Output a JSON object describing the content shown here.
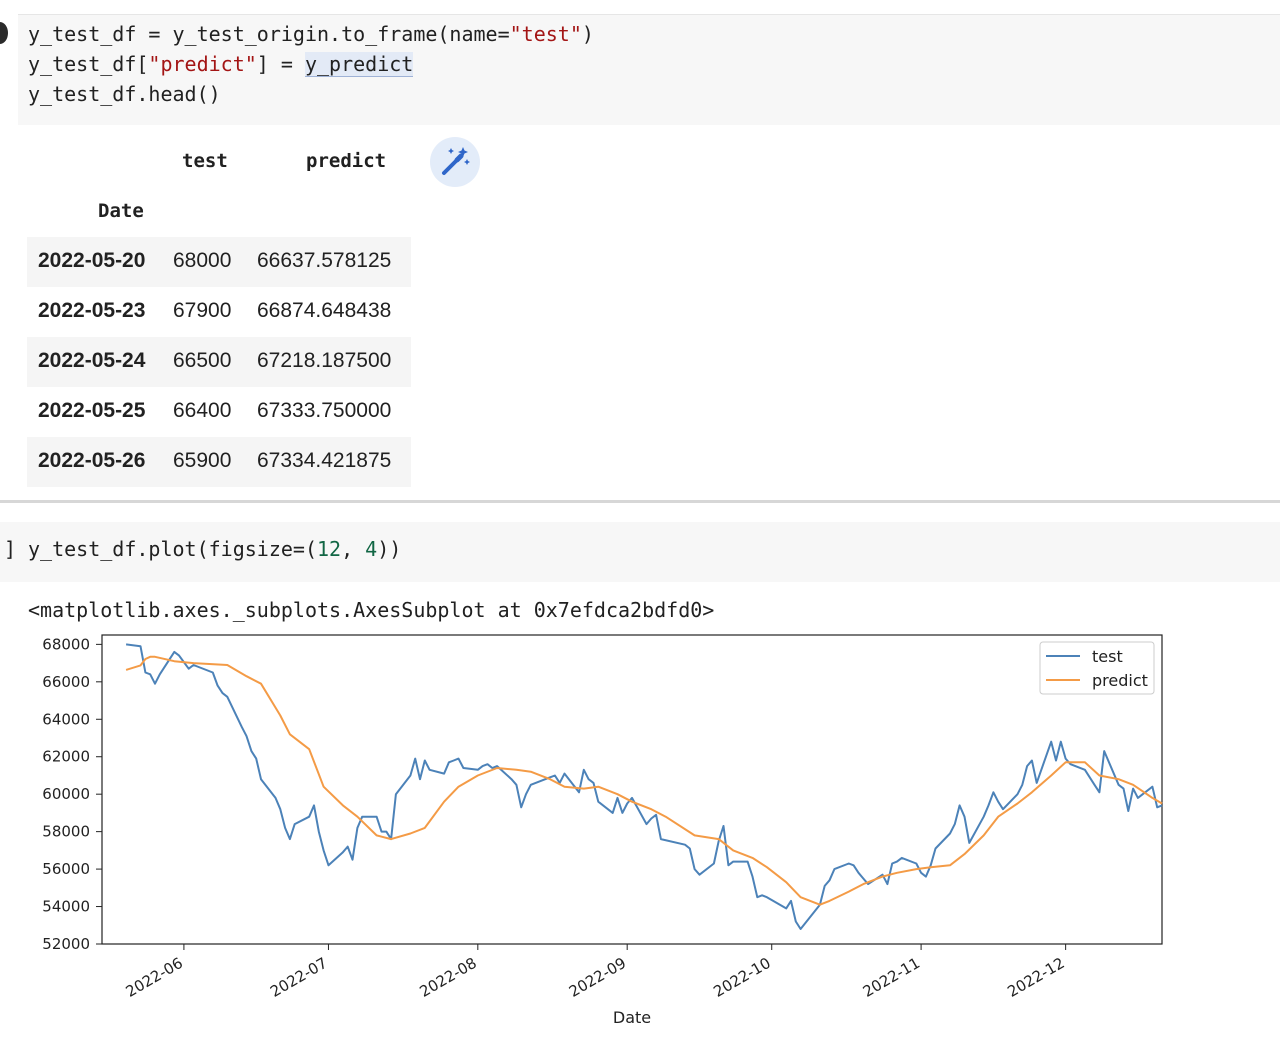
{
  "cell1": {
    "code_lines": [
      {
        "parts": [
          {
            "t": "y_test_df = y_test_origin.to_frame(name="
          },
          {
            "t": "\"test\"",
            "c": "str"
          },
          {
            "t": ")"
          }
        ]
      },
      {
        "parts": [
          {
            "t": "y_test_df["
          },
          {
            "t": "\"predict\"",
            "c": "str"
          },
          {
            "t": "] = "
          },
          {
            "t": "y_predict",
            "c": "hl"
          }
        ]
      },
      {
        "parts": [
          {
            "t": "y_test_df.head()"
          }
        ]
      }
    ]
  },
  "table": {
    "columns": [
      "test",
      "predict"
    ],
    "index_name": "Date",
    "rows": [
      {
        "date": "2022-05-20",
        "test": "68000",
        "predict": "66637.578125"
      },
      {
        "date": "2022-05-23",
        "test": "67900",
        "predict": "66874.648438"
      },
      {
        "date": "2022-05-24",
        "test": "66500",
        "predict": "67218.187500"
      },
      {
        "date": "2022-05-25",
        "test": "66400",
        "predict": "67333.750000"
      },
      {
        "date": "2022-05-26",
        "test": "65900",
        "predict": "67334.421875"
      }
    ]
  },
  "cell2": {
    "bracket": "]",
    "code_parts": [
      {
        "t": "y_test_df.plot(figsize=("
      },
      {
        "t": "12",
        "c": "num"
      },
      {
        "t": ", "
      },
      {
        "t": "4",
        "c": "num"
      },
      {
        "t": "))"
      }
    ],
    "output_repr": "<matplotlib.axes._subplots.AxesSubplot at 0x7efdca2bdfd0>"
  },
  "colors": {
    "test": "#4c82b8",
    "predict": "#f49b46",
    "string": "#a31515",
    "number": "#116644"
  },
  "chart_data": {
    "type": "line",
    "xlabel": "Date",
    "ylabel": "",
    "ylim": [
      52000,
      68500
    ],
    "xlim": [
      "2022-05-15",
      "2022-12-21"
    ],
    "yticks": [
      "52000",
      "54000",
      "56000",
      "58000",
      "60000",
      "62000",
      "64000",
      "66000",
      "68000"
    ],
    "xticks": [
      {
        "label": "2022-06",
        "date": "2022-06-01"
      },
      {
        "label": "2022-07",
        "date": "2022-07-01"
      },
      {
        "label": "2022-08",
        "date": "2022-08-01"
      },
      {
        "label": "2022-09",
        "date": "2022-09-01"
      },
      {
        "label": "2022-10",
        "date": "2022-10-01"
      },
      {
        "label": "2022-11",
        "date": "2022-11-01"
      },
      {
        "label": "2022-12",
        "date": "2022-12-01"
      }
    ],
    "legend": {
      "position": "top-right"
    },
    "series": [
      {
        "name": "test",
        "color": "#4c82b8",
        "points": [
          [
            "2022-05-20",
            68000
          ],
          [
            "2022-05-23",
            67900
          ],
          [
            "2022-05-24",
            66500
          ],
          [
            "2022-05-25",
            66400
          ],
          [
            "2022-05-26",
            65900
          ],
          [
            "2022-05-27",
            66400
          ],
          [
            "2022-05-30",
            67600
          ],
          [
            "2022-05-31",
            67400
          ],
          [
            "2022-06-02",
            66700
          ],
          [
            "2022-06-03",
            66900
          ],
          [
            "2022-06-07",
            66500
          ],
          [
            "2022-06-08",
            65800
          ],
          [
            "2022-06-09",
            65400
          ],
          [
            "2022-06-10",
            65200
          ],
          [
            "2022-06-13",
            63600
          ],
          [
            "2022-06-14",
            63100
          ],
          [
            "2022-06-15",
            62300
          ],
          [
            "2022-06-16",
            61900
          ],
          [
            "2022-06-17",
            60800
          ],
          [
            "2022-06-20",
            59800
          ],
          [
            "2022-06-21",
            59200
          ],
          [
            "2022-06-22",
            58200
          ],
          [
            "2022-06-23",
            57600
          ],
          [
            "2022-06-24",
            58400
          ],
          [
            "2022-06-27",
            58800
          ],
          [
            "2022-06-28",
            59400
          ],
          [
            "2022-06-29",
            58000
          ],
          [
            "2022-06-30",
            57000
          ],
          [
            "2022-07-01",
            56200
          ],
          [
            "2022-07-04",
            56900
          ],
          [
            "2022-07-05",
            57200
          ],
          [
            "2022-07-06",
            56500
          ],
          [
            "2022-07-07",
            58200
          ],
          [
            "2022-07-08",
            58800
          ],
          [
            "2022-07-11",
            58800
          ],
          [
            "2022-07-12",
            58000
          ],
          [
            "2022-07-13",
            58000
          ],
          [
            "2022-07-14",
            57600
          ],
          [
            "2022-07-15",
            60000
          ],
          [
            "2022-07-18",
            61000
          ],
          [
            "2022-07-19",
            61900
          ],
          [
            "2022-07-20",
            60800
          ],
          [
            "2022-07-21",
            61800
          ],
          [
            "2022-07-22",
            61300
          ],
          [
            "2022-07-25",
            61100
          ],
          [
            "2022-07-26",
            61700
          ],
          [
            "2022-07-27",
            61800
          ],
          [
            "2022-07-28",
            61900
          ],
          [
            "2022-07-29",
            61400
          ],
          [
            "2022-08-01",
            61300
          ],
          [
            "2022-08-02",
            61500
          ],
          [
            "2022-08-03",
            61600
          ],
          [
            "2022-08-04",
            61400
          ],
          [
            "2022-08-05",
            61500
          ],
          [
            "2022-08-08",
            60800
          ],
          [
            "2022-08-09",
            60500
          ],
          [
            "2022-08-10",
            59300
          ],
          [
            "2022-08-11",
            60000
          ],
          [
            "2022-08-12",
            60500
          ],
          [
            "2022-08-16",
            60900
          ],
          [
            "2022-08-17",
            61000
          ],
          [
            "2022-08-18",
            60600
          ],
          [
            "2022-08-19",
            61100
          ],
          [
            "2022-08-22",
            60100
          ],
          [
            "2022-08-23",
            61300
          ],
          [
            "2022-08-24",
            60800
          ],
          [
            "2022-08-25",
            60600
          ],
          [
            "2022-08-26",
            59600
          ],
          [
            "2022-08-29",
            59000
          ],
          [
            "2022-08-30",
            59800
          ],
          [
            "2022-08-31",
            59000
          ],
          [
            "2022-09-01",
            59500
          ],
          [
            "2022-09-02",
            59800
          ],
          [
            "2022-09-05",
            58400
          ],
          [
            "2022-09-06",
            58700
          ],
          [
            "2022-09-07",
            58900
          ],
          [
            "2022-09-08",
            57600
          ],
          [
            "2022-09-13",
            57300
          ],
          [
            "2022-09-14",
            57100
          ],
          [
            "2022-09-15",
            56000
          ],
          [
            "2022-09-16",
            55700
          ],
          [
            "2022-09-19",
            56300
          ],
          [
            "2022-09-20",
            57500
          ],
          [
            "2022-09-21",
            58300
          ],
          [
            "2022-09-22",
            56200
          ],
          [
            "2022-09-23",
            56400
          ],
          [
            "2022-09-26",
            56400
          ],
          [
            "2022-09-27",
            55600
          ],
          [
            "2022-09-28",
            54500
          ],
          [
            "2022-09-29",
            54600
          ],
          [
            "2022-09-30",
            54500
          ],
          [
            "2022-10-04",
            53900
          ],
          [
            "2022-10-05",
            54300
          ],
          [
            "2022-10-06",
            53200
          ],
          [
            "2022-10-07",
            52800
          ],
          [
            "2022-10-11",
            54100
          ],
          [
            "2022-10-12",
            55100
          ],
          [
            "2022-10-13",
            55400
          ],
          [
            "2022-10-14",
            56000
          ],
          [
            "2022-10-17",
            56300
          ],
          [
            "2022-10-18",
            56200
          ],
          [
            "2022-10-19",
            55800
          ],
          [
            "2022-10-20",
            55500
          ],
          [
            "2022-10-21",
            55200
          ],
          [
            "2022-10-24",
            55700
          ],
          [
            "2022-10-25",
            55200
          ],
          [
            "2022-10-26",
            56300
          ],
          [
            "2022-10-27",
            56400
          ],
          [
            "2022-10-28",
            56600
          ],
          [
            "2022-10-31",
            56300
          ],
          [
            "2022-11-01",
            55800
          ],
          [
            "2022-11-02",
            55600
          ],
          [
            "2022-11-03",
            56200
          ],
          [
            "2022-11-04",
            57100
          ],
          [
            "2022-11-07",
            57900
          ],
          [
            "2022-11-08",
            58400
          ],
          [
            "2022-11-09",
            59400
          ],
          [
            "2022-11-10",
            58800
          ],
          [
            "2022-11-11",
            57400
          ],
          [
            "2022-11-14",
            58800
          ],
          [
            "2022-11-15",
            59400
          ],
          [
            "2022-11-16",
            60100
          ],
          [
            "2022-11-17",
            59600
          ],
          [
            "2022-11-18",
            59200
          ],
          [
            "2022-11-21",
            60000
          ],
          [
            "2022-11-22",
            60500
          ],
          [
            "2022-11-23",
            61500
          ],
          [
            "2022-11-24",
            61800
          ],
          [
            "2022-11-25",
            60600
          ],
          [
            "2022-11-28",
            62800
          ],
          [
            "2022-11-29",
            61800
          ],
          [
            "2022-11-30",
            62800
          ],
          [
            "2022-12-01",
            61900
          ],
          [
            "2022-12-02",
            61600
          ],
          [
            "2022-12-05",
            61300
          ],
          [
            "2022-12-06",
            60900
          ],
          [
            "2022-12-07",
            60500
          ],
          [
            "2022-12-08",
            60100
          ],
          [
            "2022-12-09",
            62300
          ],
          [
            "2022-12-12",
            60500
          ],
          [
            "2022-12-13",
            60300
          ],
          [
            "2022-12-14",
            59100
          ],
          [
            "2022-12-15",
            60300
          ],
          [
            "2022-12-16",
            59800
          ],
          [
            "2022-12-19",
            60400
          ],
          [
            "2022-12-20",
            59300
          ],
          [
            "2022-12-21",
            59400
          ]
        ]
      },
      {
        "name": "predict",
        "color": "#f49b46",
        "points": [
          [
            "2022-05-20",
            66638
          ],
          [
            "2022-05-23",
            66875
          ],
          [
            "2022-05-24",
            67218
          ],
          [
            "2022-05-25",
            67334
          ],
          [
            "2022-05-26",
            67334
          ],
          [
            "2022-05-30",
            67100
          ],
          [
            "2022-06-03",
            67000
          ],
          [
            "2022-06-10",
            66900
          ],
          [
            "2022-06-14",
            66300
          ],
          [
            "2022-06-17",
            65900
          ],
          [
            "2022-06-21",
            64200
          ],
          [
            "2022-06-23",
            63200
          ],
          [
            "2022-06-27",
            62400
          ],
          [
            "2022-06-30",
            60400
          ],
          [
            "2022-07-04",
            59400
          ],
          [
            "2022-07-07",
            58800
          ],
          [
            "2022-07-11",
            57800
          ],
          [
            "2022-07-14",
            57600
          ],
          [
            "2022-07-18",
            57900
          ],
          [
            "2022-07-21",
            58200
          ],
          [
            "2022-07-25",
            59600
          ],
          [
            "2022-07-28",
            60400
          ],
          [
            "2022-08-01",
            61000
          ],
          [
            "2022-08-05",
            61400
          ],
          [
            "2022-08-09",
            61300
          ],
          [
            "2022-08-12",
            61200
          ],
          [
            "2022-08-16",
            60800
          ],
          [
            "2022-08-19",
            60400
          ],
          [
            "2022-08-23",
            60300
          ],
          [
            "2022-08-26",
            60400
          ],
          [
            "2022-08-30",
            60000
          ],
          [
            "2022-09-02",
            59600
          ],
          [
            "2022-09-06",
            59200
          ],
          [
            "2022-09-09",
            58800
          ],
          [
            "2022-09-15",
            57800
          ],
          [
            "2022-09-20",
            57600
          ],
          [
            "2022-09-23",
            57000
          ],
          [
            "2022-09-27",
            56600
          ],
          [
            "2022-09-30",
            56100
          ],
          [
            "2022-10-04",
            55300
          ],
          [
            "2022-10-07",
            54500
          ],
          [
            "2022-10-11",
            54100
          ],
          [
            "2022-10-13",
            54300
          ],
          [
            "2022-10-17",
            54800
          ],
          [
            "2022-10-20",
            55200
          ],
          [
            "2022-10-24",
            55600
          ],
          [
            "2022-10-27",
            55800
          ],
          [
            "2022-10-31",
            56000
          ],
          [
            "2022-11-03",
            56100
          ],
          [
            "2022-11-07",
            56200
          ],
          [
            "2022-11-10",
            56800
          ],
          [
            "2022-11-14",
            57800
          ],
          [
            "2022-11-17",
            58800
          ],
          [
            "2022-11-21",
            59500
          ],
          [
            "2022-11-24",
            60100
          ],
          [
            "2022-11-28",
            61000
          ],
          [
            "2022-12-01",
            61700
          ],
          [
            "2022-12-05",
            61700
          ],
          [
            "2022-12-08",
            61000
          ],
          [
            "2022-12-12",
            60800
          ],
          [
            "2022-12-15",
            60500
          ],
          [
            "2022-12-19",
            59800
          ],
          [
            "2022-12-21",
            59500
          ]
        ]
      }
    ]
  }
}
